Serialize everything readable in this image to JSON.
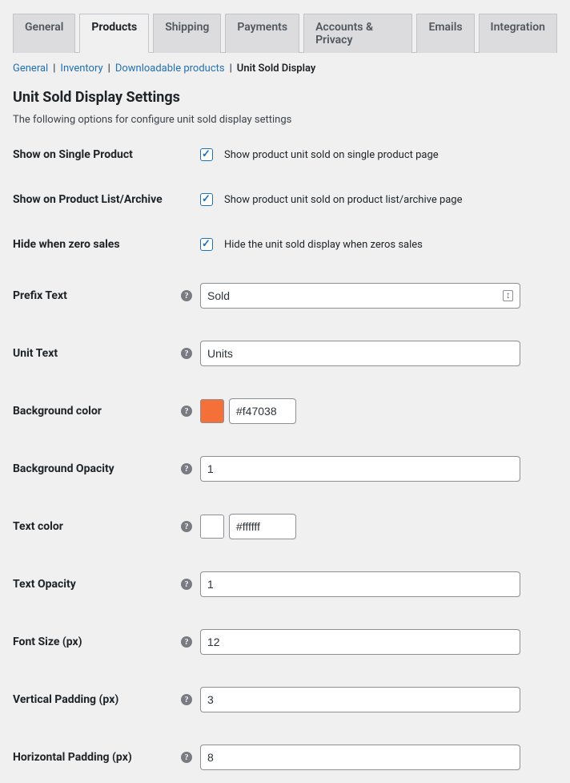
{
  "tabs": {
    "general": "General",
    "products": "Products",
    "shipping": "Shipping",
    "payments": "Payments",
    "accounts": "Accounts & Privacy",
    "emails": "Emails",
    "integration": "Integration"
  },
  "subnav": {
    "general": "General",
    "inventory": "Inventory",
    "downloadable": "Downloadable products",
    "current": "Unit Sold Display"
  },
  "heading": "Unit Sold Display Settings",
  "description": "The following options for configure unit sold display settings",
  "fields": {
    "show_single": {
      "label": "Show on Single Product",
      "desc": "Show product unit sold on single product page"
    },
    "show_archive": {
      "label": "Show on Product List/Archive",
      "desc": "Show product unit sold on product list/archive page"
    },
    "hide_zero": {
      "label": "Hide when zero sales",
      "desc": "Hide the unit sold display when zeros sales"
    },
    "prefix": {
      "label": "Prefix Text",
      "value": "Sold"
    },
    "unit": {
      "label": "Unit Text",
      "value": "Units"
    },
    "bgcolor": {
      "label": "Background color",
      "value": "#f47038",
      "swatch": "#f47038"
    },
    "bgopacity": {
      "label": "Background Opacity",
      "value": "1"
    },
    "textcolor": {
      "label": "Text color",
      "value": "#ffffff",
      "swatch": "#ffffff"
    },
    "textopacity": {
      "label": "Text Opacity",
      "value": "1"
    },
    "fontsize": {
      "label": "Font Size (px)",
      "value": "12"
    },
    "vpad": {
      "label": "Vertical Padding (px)",
      "value": "3"
    },
    "hpad": {
      "label": "Horizontal Padding (px)",
      "value": "8"
    }
  }
}
